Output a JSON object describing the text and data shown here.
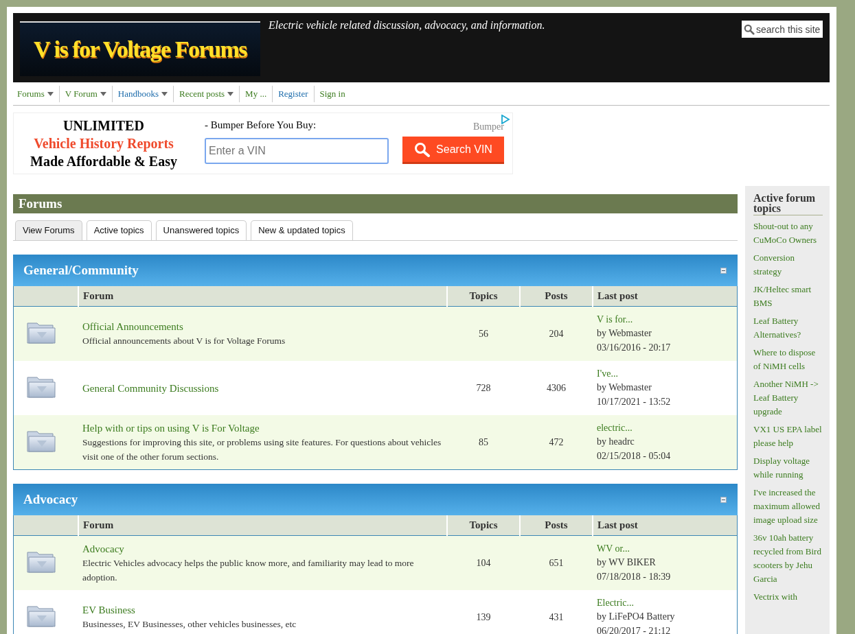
{
  "header": {
    "logo": "V is for Voltage Forums",
    "tagline": "Electric vehicle related discussion, advocacy, and information.",
    "search": {
      "placeholder": "search this site"
    }
  },
  "nav": [
    {
      "label": "Forums",
      "dropdown": true,
      "visited": true
    },
    {
      "label": "V Forum",
      "dropdown": true,
      "visited": true
    },
    {
      "label": "Handbooks",
      "dropdown": true,
      "visited": false
    },
    {
      "label": "Recent posts",
      "dropdown": true,
      "visited": true
    },
    {
      "label": "My ...",
      "dropdown": false,
      "visited": true
    },
    {
      "label": "Register",
      "dropdown": false,
      "visited": false
    },
    {
      "label": "Sign in",
      "dropdown": false,
      "visited": true
    }
  ],
  "ad": {
    "line_1": "UNLIMITED",
    "line_2": "Vehicle History Reports",
    "line_3": "Made Affordable & Easy",
    "tagline": "- Bumper Before You Buy:",
    "advertiser": "Bumper",
    "vin_field": {
      "placeholder": "Enter a VIN"
    },
    "button": "Search VIN"
  },
  "page_title": "Forums",
  "tabs": [
    {
      "label": "View Forums",
      "selected": true
    },
    {
      "label": "Active topics",
      "selected": false
    },
    {
      "label": "Unanswered topics",
      "selected": false
    },
    {
      "label": "New & updated topics",
      "selected": false
    }
  ],
  "categories": [
    {
      "title": "General/Community",
      "expanded": true,
      "columns": [
        "Forum",
        "Topics",
        "Posts",
        "Last post"
      ],
      "rows": [
        {
          "name": "Official Announcements",
          "description": "Official announcements about V is for Voltage Forums",
          "topics": "56",
          "posts": "204",
          "last_post": {
            "title": "V is for...",
            "author": "by Webmaster",
            "date": "03/16/2016 - 20:17"
          }
        },
        {
          "name": "General Community Discussions",
          "description": "",
          "topics": "728",
          "posts": "4306",
          "last_post": {
            "title": "I've...",
            "author": "by Webmaster",
            "date": "10/17/2021 - 13:52"
          }
        },
        {
          "name": "Help with or tips on using V is For Voltage",
          "description": "Suggestions for improving this site, or problems using site features. For questions about vehicles visit one of the other forum sections.",
          "topics": "85",
          "posts": "472",
          "last_post": {
            "title": "electric...",
            "author": "by headrc",
            "date": "02/15/2018 - 05:04"
          }
        }
      ]
    },
    {
      "title": "Advocacy",
      "expanded": true,
      "columns": [
        "Forum",
        "Topics",
        "Posts",
        "Last post"
      ],
      "rows": [
        {
          "name": "Advocacy",
          "description": "Electric Vehicles advocacy helps the public know more, and familiarity may lead to more adoption.",
          "topics": "104",
          "posts": "651",
          "last_post": {
            "title": "WV or...",
            "author": "by WV BIKER",
            "date": "07/18/2018 - 18:39"
          }
        },
        {
          "name": "EV Business",
          "description": "Businesses, EV Businesses, other vehicles businesses, etc",
          "topics": "139",
          "posts": "431",
          "last_post": {
            "title": "Electric...",
            "author": "by LiFePO4 Battery",
            "date": "06/20/2017 - 21:12"
          }
        }
      ]
    }
  ],
  "sidebar": {
    "title": "Active forum topics",
    "items": [
      "Shout-out to any CuMoCo Owners",
      "Conversion strategy",
      "JK/Heltec smart BMS",
      "Leaf Battery Alternatives?",
      "Where to dispose of NiMH cells",
      "Another NiMH -> Leaf Battery upgrade",
      "VX1 US EPA label please help",
      "Display voltage while running",
      "I've increased the maximum allowed image upload size",
      "36v 10ah battery recycled from Bird scooters by Jehu Garcia",
      "Vectrix with"
    ]
  }
}
